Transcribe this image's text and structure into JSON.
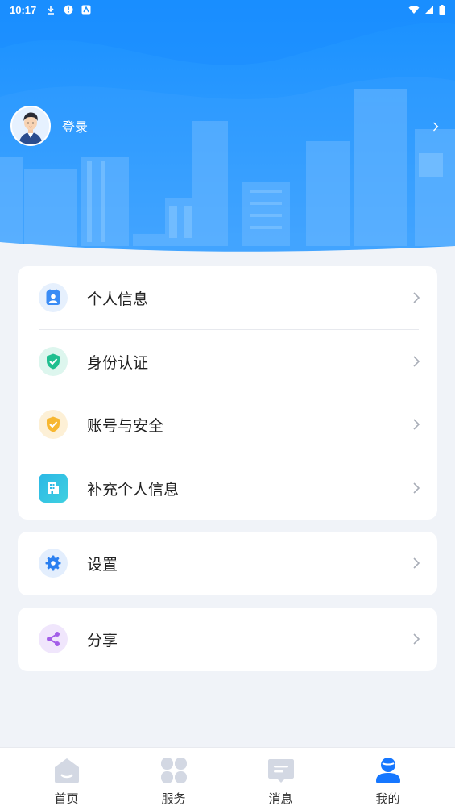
{
  "status_bar": {
    "time": "10:17"
  },
  "profile": {
    "login_label": "登录"
  },
  "menu_group_1": [
    {
      "label": "个人信息",
      "icon": "contact-card-icon",
      "color": "#3a8cf5",
      "bg": "#e6f0fd"
    },
    {
      "label": "身份认证",
      "icon": "shield-check-icon",
      "color": "#1fbf8f",
      "bg": "#ddf6ee"
    },
    {
      "label": "账号与安全",
      "icon": "shield-check-icon",
      "color": "#f7b731",
      "bg": "#fdf0d6"
    },
    {
      "label": "补充个人信息",
      "icon": "building-icon",
      "color": "#2bb8e6",
      "bg": "#2bb8e6"
    }
  ],
  "menu_group_2": [
    {
      "label": "设置",
      "icon": "gear-icon",
      "color": "#2a7ff0",
      "bg": "#e3eefd"
    }
  ],
  "menu_group_3": [
    {
      "label": "分享",
      "icon": "share-icon",
      "color": "#a35ee8",
      "bg": "#f0e6fc"
    }
  ],
  "bottom_nav": [
    {
      "label": "首页",
      "icon": "home-icon",
      "active": false
    },
    {
      "label": "服务",
      "icon": "grid-icon",
      "active": false
    },
    {
      "label": "消息",
      "icon": "message-icon",
      "active": false
    },
    {
      "label": "我的",
      "icon": "user-icon",
      "active": true
    }
  ],
  "colors": {
    "primary": "#1890ff",
    "inactive_icon": "#d3d8e3",
    "active_icon": "#1677ff",
    "page_bg": "#f0f3f8"
  }
}
